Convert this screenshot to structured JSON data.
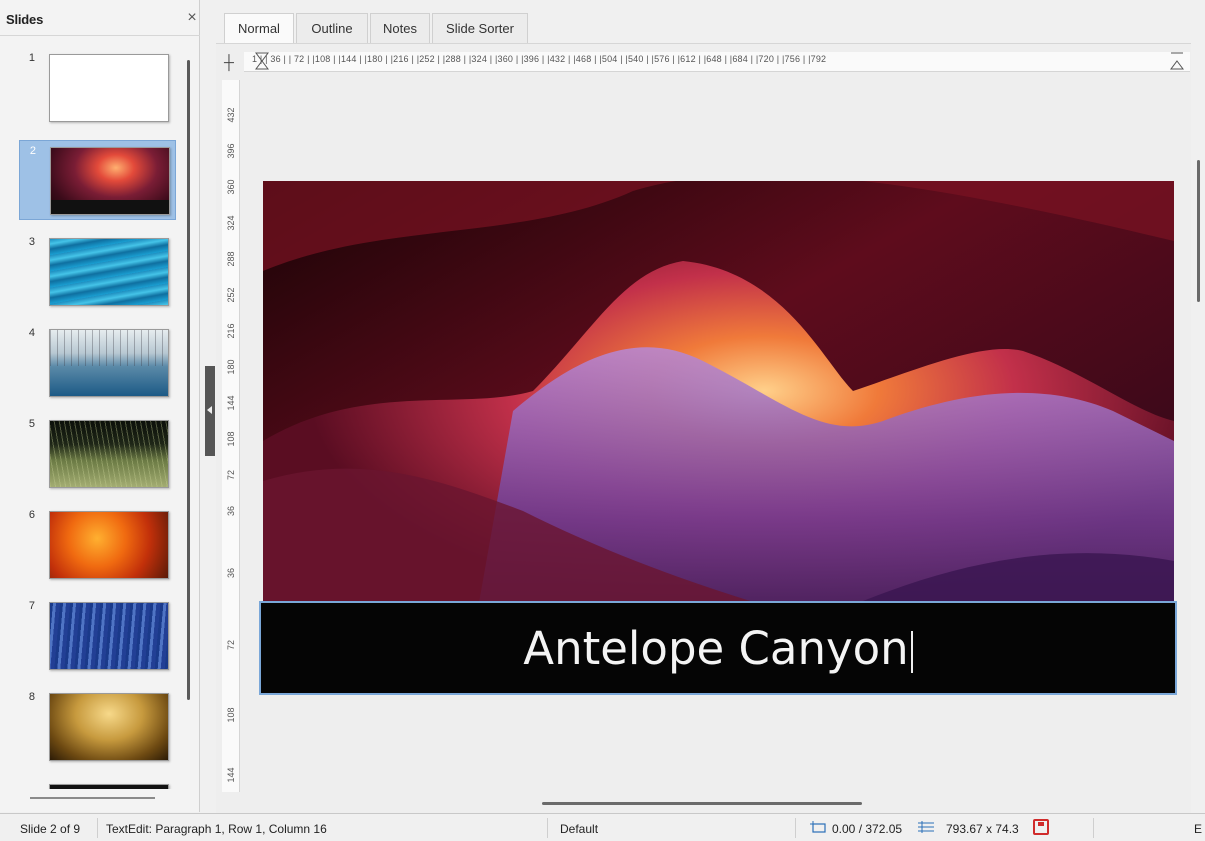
{
  "slides_panel": {
    "title": "Slides",
    "close_glyph": "×",
    "items": [
      {
        "number": "1",
        "thumb": "blank-white"
      },
      {
        "number": "2",
        "thumb": "antelope-canyon"
      },
      {
        "number": "3",
        "thumb": "blue-water"
      },
      {
        "number": "4",
        "thumb": "frosted-trees-lake"
      },
      {
        "number": "5",
        "thumb": "grass-field"
      },
      {
        "number": "6",
        "thumb": "orange-abstract"
      },
      {
        "number": "7",
        "thumb": "blue-texture"
      },
      {
        "number": "8",
        "thumb": "golden-cave"
      }
    ],
    "selected_index": 1
  },
  "tabs": [
    "Normal",
    "Outline",
    "Notes",
    "Slide Sorter"
  ],
  "active_tab": "Normal",
  "ruler": {
    "horizontal_labels": "1 | | 36 | | 72 | |108 | |144 | |180 | |216 | |252 | |288 | |324 | |360 | |396 | |432 | |468 | |504 | |540 | |576 | |612 | |648 | |684 | |720 | |756 | |792",
    "vertical_labels": [
      "432",
      "396",
      "360",
      "324",
      "288",
      "252",
      "216",
      "180",
      "144",
      "108",
      "72",
      "36",
      "36",
      "72",
      "108",
      "144"
    ]
  },
  "slide": {
    "title_text": "Antelope Canyon",
    "image": "antelope-canyon-photo"
  },
  "statusbar": {
    "slide_position": "Slide 2 of 9",
    "edit_status": "TextEdit: Paragraph 1, Row 1, Column 16",
    "layout": "Default",
    "position": "0.00 / 372.05",
    "size": "793.67 x 74.3",
    "language": "E"
  }
}
